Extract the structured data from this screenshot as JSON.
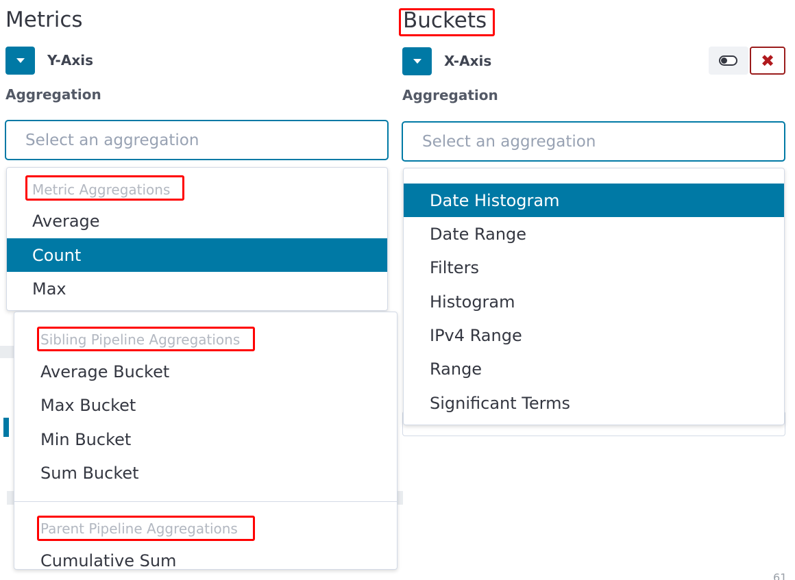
{
  "metrics": {
    "title": "Metrics",
    "axis_label": "Y-Axis",
    "aggregation_label": "Aggregation",
    "placeholder": "Select an aggregation",
    "dropdown": {
      "group": "Metric Aggregations",
      "options": [
        "Average",
        "Count",
        "Max"
      ],
      "selected": "Count"
    },
    "pipeline_dropdown": {
      "sibling_group": "Sibling Pipeline Aggregations",
      "sibling_options": [
        "Average Bucket",
        "Max Bucket",
        "Min Bucket",
        "Sum Bucket"
      ],
      "parent_group": "Parent Pipeline Aggregations",
      "parent_options": [
        "Cumulative Sum"
      ]
    }
  },
  "buckets": {
    "title": "Buckets",
    "axis_label": "X-Axis",
    "aggregation_label": "Aggregation",
    "placeholder": "Select an aggregation",
    "dropdown": {
      "options": [
        "Date Histogram",
        "Date Range",
        "Filters",
        "Histogram",
        "IPv4 Range",
        "Range",
        "Significant Terms"
      ],
      "selected": "Date Histogram"
    },
    "toggle_icon": "toggle-icon",
    "close_icon": "close-icon",
    "close_symbol": "✖"
  },
  "footer": {
    "page_number": "61"
  },
  "colors": {
    "accent": "#0079a5",
    "highlight": "#ff0000",
    "danger": "#b0191d"
  }
}
